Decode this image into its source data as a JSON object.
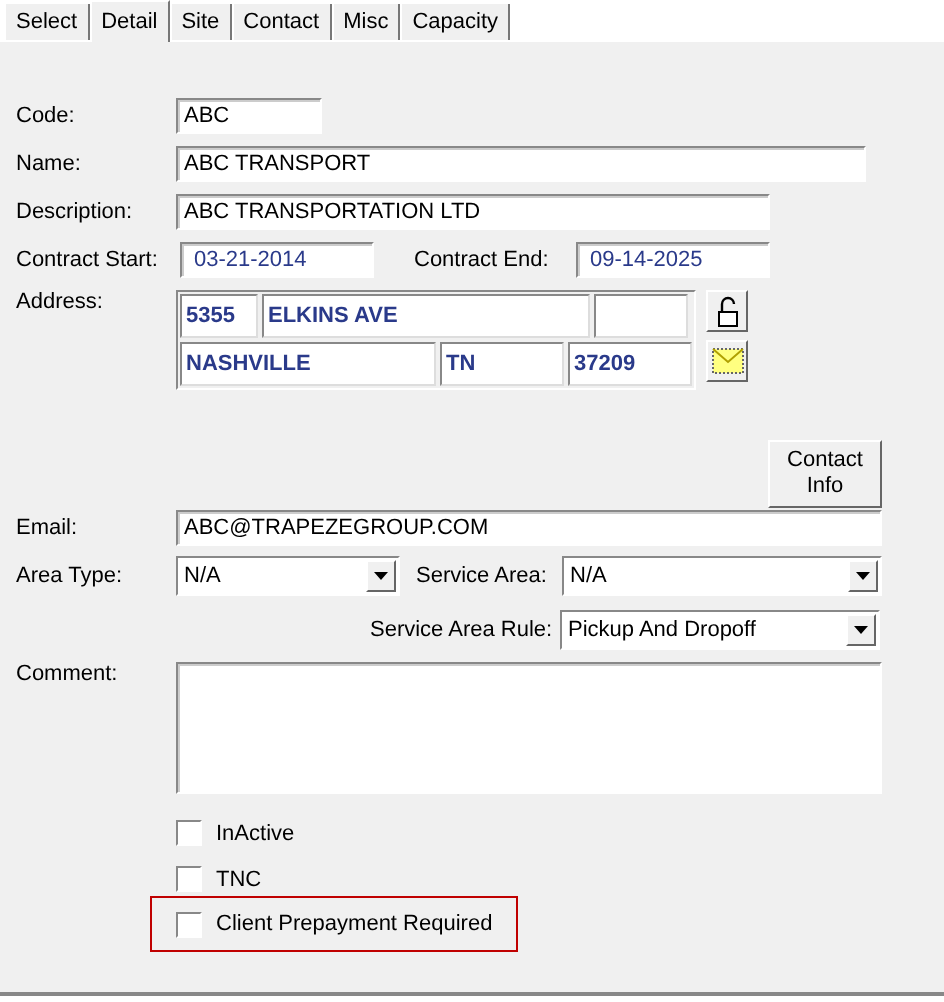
{
  "tabs": [
    {
      "label": "Select",
      "selected": false
    },
    {
      "label": "Detail",
      "selected": true
    },
    {
      "label": "Site",
      "selected": false
    },
    {
      "label": "Contact",
      "selected": false
    },
    {
      "label": "Misc",
      "selected": false
    },
    {
      "label": "Capacity",
      "selected": false
    }
  ],
  "code": {
    "label": "Code:",
    "value": "ABC"
  },
  "name": {
    "label": "Name:",
    "value": "ABC TRANSPORT"
  },
  "description": {
    "label": "Description:",
    "value": "ABC TRANSPORTATION LTD"
  },
  "contract_start": {
    "label": "Contract Start:",
    "value": "03-21-2014"
  },
  "contract_end": {
    "label": "Contract End:",
    "value": "09-14-2025"
  },
  "address": {
    "label": "Address:",
    "number": "5355",
    "street": "ELKINS AVE",
    "city": "NASHVILLE",
    "state": "TN",
    "zip": "37209"
  },
  "contact_info_button": "Contact Info",
  "email": {
    "label": "Email:",
    "value": "ABC@TRAPEZEGROUP.COM"
  },
  "area_type": {
    "label": "Area Type:",
    "value": "N/A"
  },
  "service_area": {
    "label": "Service Area:",
    "value": "N/A"
  },
  "service_area_rule": {
    "label": "Service Area Rule:",
    "value": "Pickup And Dropoff"
  },
  "comment": {
    "label": "Comment:"
  },
  "checkboxes": [
    {
      "label": "InActive",
      "checked": false,
      "highlighted": false
    },
    {
      "label": "TNC",
      "checked": false,
      "highlighted": false
    },
    {
      "label": "Client Prepayment Required",
      "checked": false,
      "highlighted": true
    }
  ]
}
